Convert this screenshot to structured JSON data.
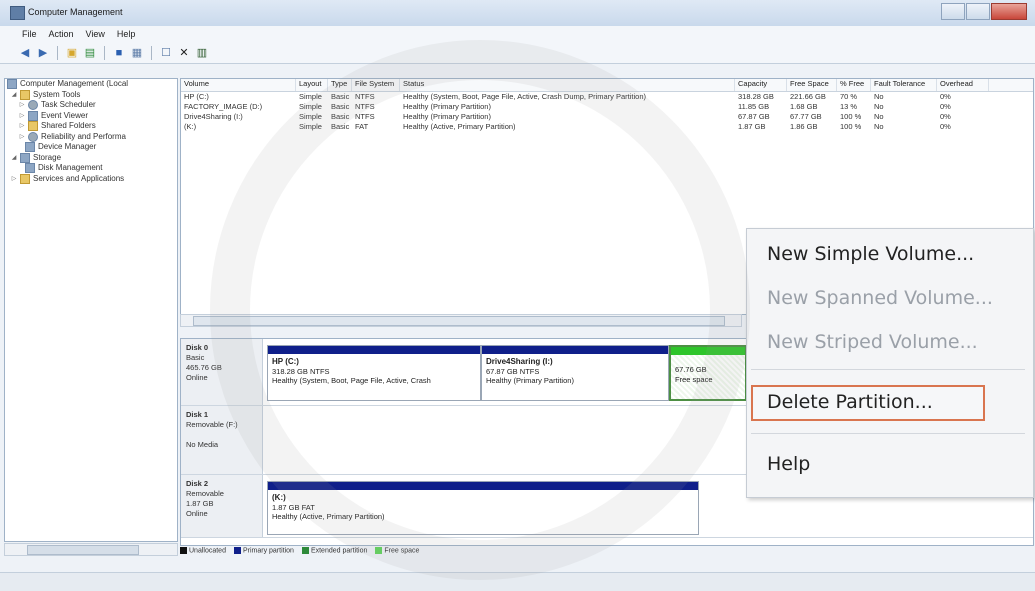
{
  "window": {
    "title": "Computer Management"
  },
  "menu": [
    "File",
    "Action",
    "View",
    "Help"
  ],
  "tree": [
    {
      "label": "Computer Management (Local",
      "indent": 0,
      "icon": "computer-icon"
    },
    {
      "label": "System Tools",
      "indent": 1,
      "icon": "folder-icon"
    },
    {
      "label": "Task Scheduler",
      "indent": 2,
      "icon": "clock-icon"
    },
    {
      "label": "Event Viewer",
      "indent": 2,
      "icon": "event-viewer-icon"
    },
    {
      "label": "Shared Folders",
      "indent": 2,
      "icon": "folder-icon"
    },
    {
      "label": "Reliability and Performa",
      "indent": 2,
      "icon": "gear-icon"
    },
    {
      "label": "Device Manager",
      "indent": 2,
      "icon": "device-icon"
    },
    {
      "label": "Storage",
      "indent": 1,
      "icon": "storage-icon"
    },
    {
      "label": "Disk Management",
      "indent": 2,
      "icon": "disk-icon"
    },
    {
      "label": "Services and Applications",
      "indent": 1,
      "icon": "folder-icon"
    }
  ],
  "volumes": {
    "headers": [
      "Volume",
      "Layout",
      "Type",
      "File System",
      "Status",
      "Capacity",
      "Free Space",
      "% Free",
      "Fault Tolerance",
      "Overhead"
    ],
    "rows": [
      [
        "HP (C:)",
        "Simple",
        "Basic",
        "NTFS",
        "Healthy (System, Boot, Page File, Active, Crash Dump, Primary Partition)",
        "318.28 GB",
        "221.66 GB",
        "70 %",
        "No",
        "0%"
      ],
      [
        "FACTORY_IMAGE (D:)",
        "Simple",
        "Basic",
        "NTFS",
        "Healthy (Primary Partition)",
        "11.85 GB",
        "1.68 GB",
        "13 %",
        "No",
        "0%"
      ],
      [
        "Drive4Sharing (I:)",
        "Simple",
        "Basic",
        "NTFS",
        "Healthy (Primary Partition)",
        "67.87 GB",
        "67.77 GB",
        "100 %",
        "No",
        "0%"
      ],
      [
        "(K:)",
        "Simple",
        "Basic",
        "FAT",
        "Healthy (Active, Primary Partition)",
        "1.87 GB",
        "1.86 GB",
        "100 %",
        "No",
        "0%"
      ]
    ]
  },
  "disks": {
    "disk0": {
      "name": "Disk 0",
      "type": "Basic",
      "size": "465.76 GB",
      "status": "Online",
      "p1": {
        "name": "HP (C:)",
        "size": "318.28 GB NTFS",
        "status": "Healthy (System, Boot, Page File, Active, Crash"
      },
      "p2": {
        "name": "Drive4Sharing (I:)",
        "size": "67.87 GB NTFS",
        "status": "Healthy (Primary Partition)"
      },
      "p3": {
        "size": "67.76 GB",
        "status": "Free space"
      }
    },
    "disk1": {
      "name": "Disk 1",
      "type": "Removable (F:)",
      "status": "No Media"
    },
    "disk2": {
      "name": "Disk 2",
      "type": "Removable",
      "size": "1.87 GB",
      "status": "Online",
      "p1": {
        "name": "(K:)",
        "size": "1.87 GB FAT",
        "status": "Healthy (Active, Primary Partition)"
      }
    }
  },
  "legend": [
    {
      "label": "Unallocated",
      "color": "#111111"
    },
    {
      "label": "Primary partition",
      "color": "#0f1f8a"
    },
    {
      "label": "Extended partition",
      "color": "#2e8a3a"
    },
    {
      "label": "Free space",
      "color": "#5fd35b"
    }
  ],
  "context_menu": {
    "new_simple": "New Simple Volume...",
    "new_spanned": "New Spanned Volume...",
    "new_striped": "New Striped Volume...",
    "delete": "Delete Partition...",
    "help": "Help"
  }
}
